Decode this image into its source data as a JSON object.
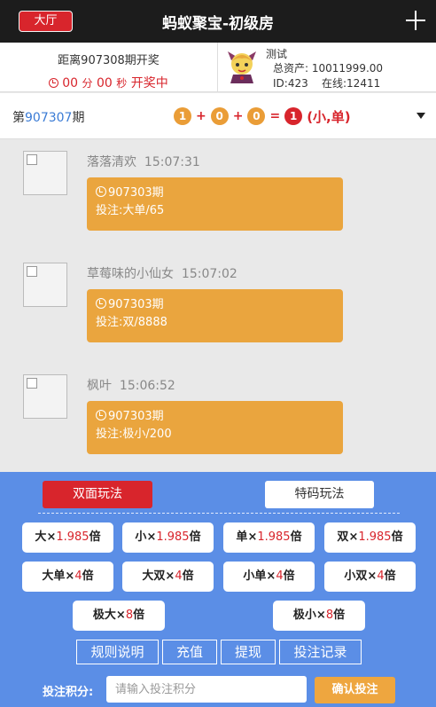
{
  "header": {
    "lobby_label": "大厅",
    "title": "蚂蚁聚宝-初级房",
    "add_icon": "plus-icon"
  },
  "info": {
    "next_issue_text": "距离907308期开奖",
    "countdown": {
      "minutes": "00",
      "min_unit": "分",
      "seconds": "00",
      "sec_unit": "秒",
      "status": "开奖中"
    },
    "user": {
      "name": "测试",
      "assets_label": "总资产:",
      "assets_value": "10011999.00",
      "id_text": "ID:423",
      "online_text": "在线:12411"
    }
  },
  "last_draw": {
    "prefix": "第",
    "issue": "907307",
    "suffix": "期",
    "balls": [
      "1",
      "0",
      "0"
    ],
    "plus": "+",
    "equals": "=",
    "sum": "1",
    "result": "(小,单)"
  },
  "messages": [
    {
      "user": "落落清欢",
      "time": "15:07:31",
      "issue": "907303期",
      "bet_label": "投注:",
      "bet": "大单/65"
    },
    {
      "user": "草莓味的小仙女",
      "time": "15:07:02",
      "issue": "907303期",
      "bet_label": "投注:",
      "bet": "双/8888"
    },
    {
      "user": "枫叶",
      "time": "15:06:52",
      "issue": "907303期",
      "bet_label": "投注:",
      "bet": "极小/200"
    }
  ],
  "panel": {
    "tab_double": "双面玩法",
    "tab_special": "特码玩法",
    "options": [
      {
        "name": "大",
        "mult": "1.985",
        "unit": "倍"
      },
      {
        "name": "小",
        "mult": "1.985",
        "unit": "倍"
      },
      {
        "name": "单",
        "mult": "1.985",
        "unit": "倍"
      },
      {
        "name": "双",
        "mult": "1.985",
        "unit": "倍"
      },
      {
        "name": "大单",
        "mult": "4",
        "unit": "倍"
      },
      {
        "name": "大双",
        "mult": "4",
        "unit": "倍"
      },
      {
        "name": "小单",
        "mult": "4",
        "unit": "倍"
      },
      {
        "name": "小双",
        "mult": "4",
        "unit": "倍"
      },
      {
        "name": "极大",
        "mult": "8",
        "unit": "倍"
      },
      {
        "name": "极小",
        "mult": "8",
        "unit": "倍"
      }
    ],
    "times": "×",
    "links": [
      "规则说明",
      "充值",
      "提现",
      "投注记录"
    ],
    "bet_label": "投注积分:",
    "bet_placeholder": "请输入投注积分",
    "confirm_label": "确认投注"
  },
  "colors": {
    "header_bg": "#1c1c1c",
    "accent_red": "#d8252c",
    "bubble_orange": "#eaa53e",
    "panel_blue": "#5b8ee6",
    "link_blue": "#3a7bd5"
  }
}
